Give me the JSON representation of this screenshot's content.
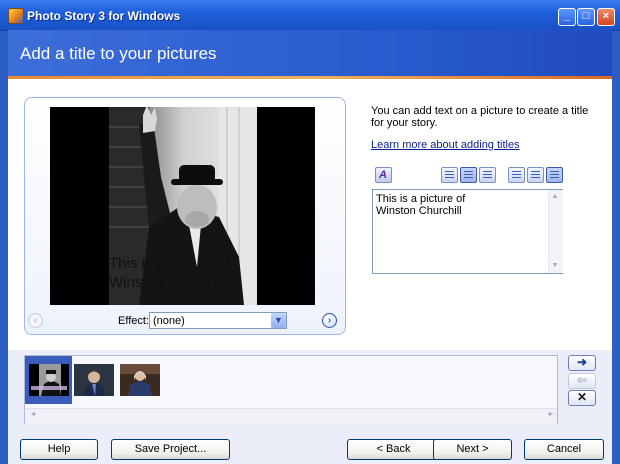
{
  "window": {
    "title": "Photo Story 3 for Windows",
    "minimize": "_",
    "maximize": "□",
    "close": "×"
  },
  "header": {
    "title": "Add a title to your pictures"
  },
  "preview": {
    "overlay_text_line1": "This is a picture of",
    "overlay_text_line2": "Winston Churchill",
    "prev_icon": "‹",
    "next_icon": "›",
    "effect_label": "Effect:",
    "effect_value": "(none)",
    "effect_arrow": "▼"
  },
  "side": {
    "instruction": "You can add text on a picture to create a title for your story.",
    "learn_more_link": "Learn more about adding titles",
    "font_glyph": "A",
    "title_text": "This is a picture of\nWinston Churchill",
    "scroll_up": "▲",
    "scroll_down": "▼"
  },
  "filmstrip": {
    "thumbnails": [
      "winston-churchill-photo",
      "portrait-photo-2",
      "portrait-photo-3"
    ],
    "scroll_left": "◄",
    "scroll_right": "►",
    "move_right_icon": "➜",
    "move_left_icon": "⇦",
    "remove_icon": "✕"
  },
  "buttons": {
    "help": "Help",
    "save_project": "Save Project...",
    "back": "< Back",
    "next": "Next >",
    "cancel": "Cancel"
  },
  "colors": {
    "titlebar": "#1f5fdc",
    "header": "#2a5bd0",
    "accent_line": "#e88a30",
    "selected_thumb": "#3a5cbd"
  }
}
